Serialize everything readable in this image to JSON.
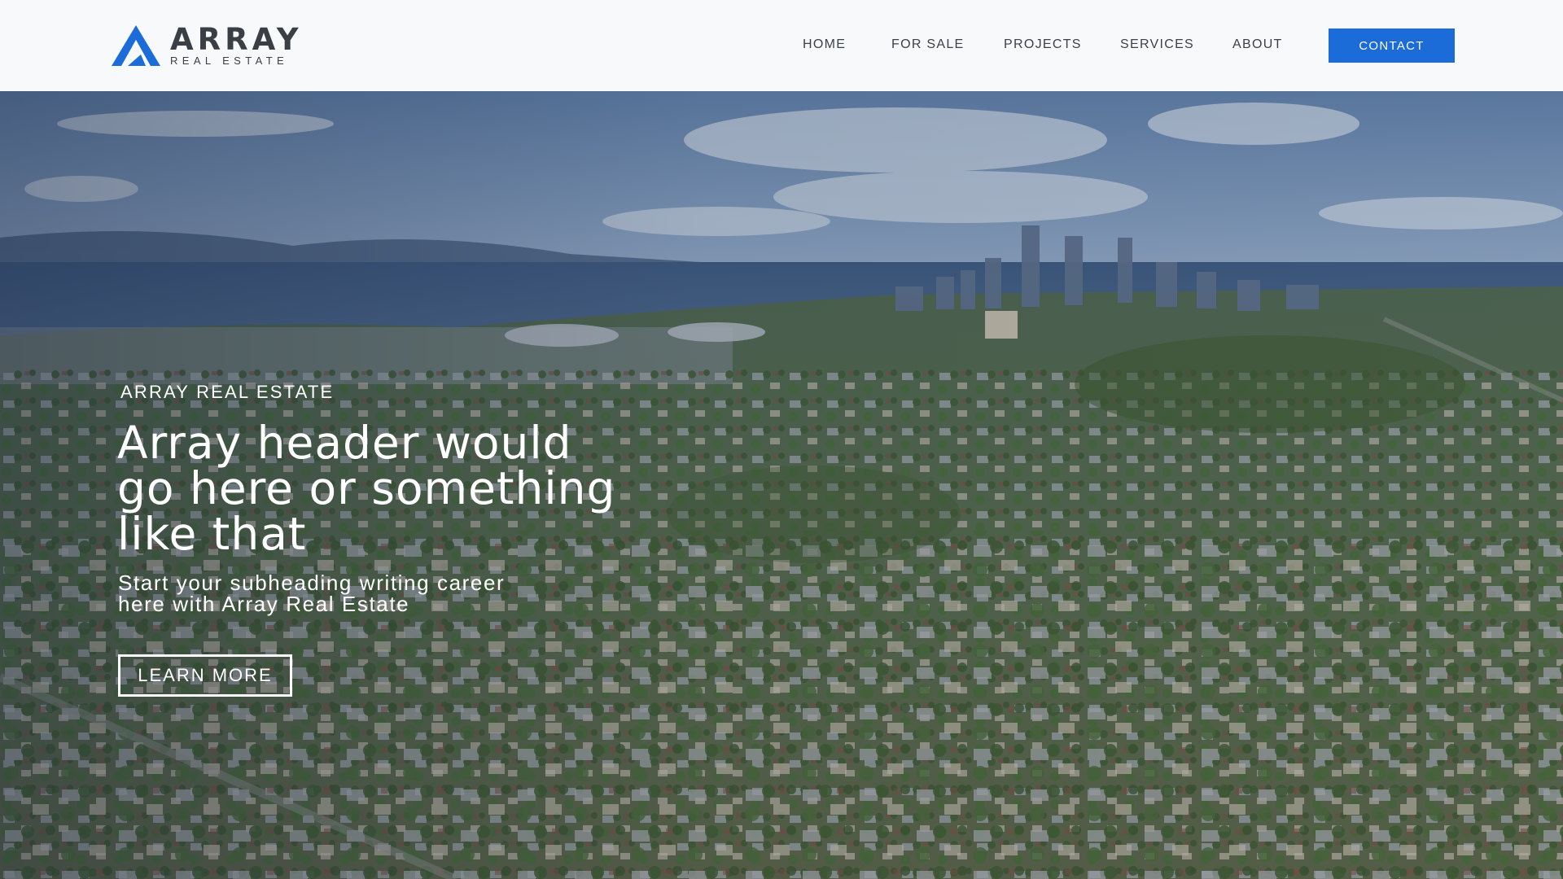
{
  "brand": {
    "name": "ARRAY",
    "tagline": "REAL ESTATE",
    "logo_icon": "array-a-mark-icon",
    "colors": {
      "primary_blue": "#1b6bd8",
      "dark_gray": "#3a3e45"
    }
  },
  "nav": {
    "items": [
      {
        "label": "HOME"
      },
      {
        "label": "FOR SALE"
      },
      {
        "label": "PROJECTS"
      },
      {
        "label": "SERVICES"
      },
      {
        "label": "ABOUT"
      }
    ],
    "contact_label": "CONTACT"
  },
  "hero": {
    "eyebrow": "ARRAY REAL ESTATE",
    "headline": "Array header would go here or something like that",
    "subheading": "Start your subheading writing career here with Array Real Estate",
    "cta_label": "LEARN MORE"
  }
}
